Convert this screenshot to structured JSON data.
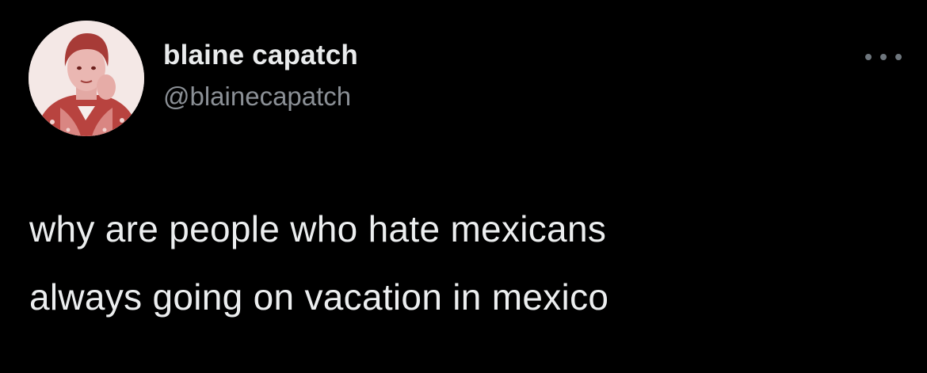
{
  "tweet": {
    "author": {
      "display_name": "blaine capatch",
      "handle": "@blainecapatch",
      "avatar_icon": "avatar-photo",
      "avatar_tint": "#c9524c"
    },
    "more_icon": "more-options-icon",
    "text_lines": [
      "why are people who hate mexicans",
      "always going on vacation in mexico"
    ]
  },
  "colors": {
    "background": "#000000",
    "name": "#e9ebec",
    "handle": "#8b9096",
    "text": "#eceeef"
  }
}
